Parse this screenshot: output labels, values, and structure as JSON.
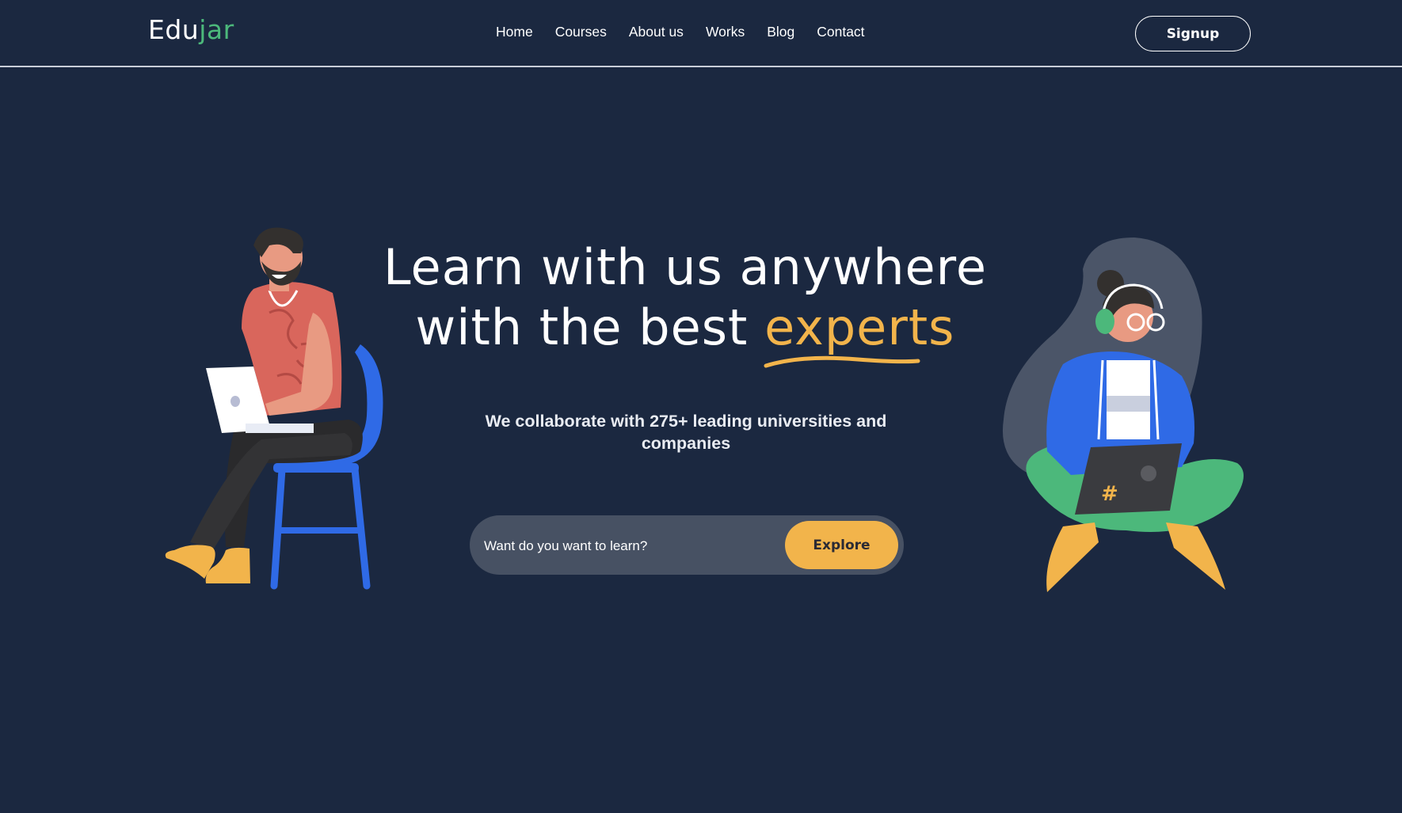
{
  "header": {
    "logo_part1": "Edu",
    "logo_part2": "jar",
    "nav": [
      "Home",
      "Courses",
      "About us",
      "Works",
      "Blog",
      "Contact"
    ],
    "signup_label": "Signup"
  },
  "hero": {
    "headline_line1": "Learn with us anywhere",
    "headline_line2_prefix": "with the best ",
    "headline_accent": "experts",
    "subtitle": "We collaborate with 275+ leading universities and companies",
    "search_placeholder": "Want do you want to learn?",
    "explore_label": "Explore",
    "laptop_badge": "#"
  },
  "colors": {
    "background": "#1b2840",
    "accent_yellow": "#f2b44b",
    "logo_green": "#4cb87b",
    "search_bg": "#475163",
    "chair_blue": "#2f6ae6"
  },
  "icons": {
    "left_illustration": "man-on-chair-with-laptop-illustration",
    "right_illustration": "woman-with-headset-and-laptop-illustration"
  }
}
